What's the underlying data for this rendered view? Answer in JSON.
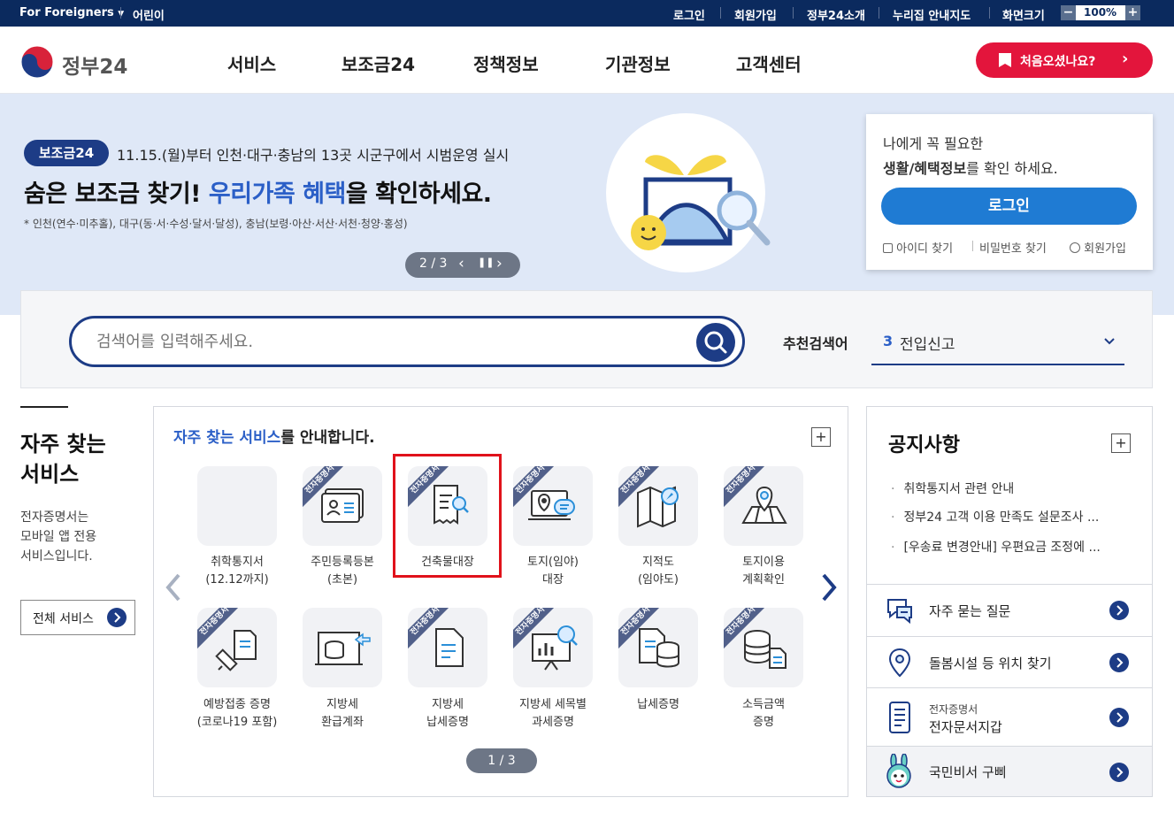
{
  "topbar": {
    "for_foreigners": "For Foreigners",
    "kids": "어린이",
    "login": "로그인",
    "signup": "회원가입",
    "about": "정부24소개",
    "sitemap": "누리집 안내지도",
    "screen_size": "화면크기",
    "zoom_minus": "−",
    "zoom_value": "100%",
    "zoom_plus": "+"
  },
  "header": {
    "logo_text": "정부24",
    "nav": [
      "서비스",
      "보조금24",
      "정책정보",
      "기관정보",
      "고객센터"
    ],
    "first_visit": "처음오셨나요?"
  },
  "hero": {
    "badge": "보조금24",
    "notice": "11.15.(월)부터 인천·대구·충남의 13곳 시군구에서 시범운영 실시",
    "headline_a": "숨은 보조금 찾기! ",
    "headline_b": "우리가족 혜택",
    "headline_c": "을 확인하세요.",
    "subnote": "* 인천(연수·미추홀), 대구(동·서·수성·달서·달성), 충남(보령·아산·서산·서천·청양·홍성)",
    "pager": "2 / 3"
  },
  "login_card": {
    "line1": "나에게 꼭 필요한",
    "line2_bold": "생활/혜택정보",
    "line2_rest": "를 확인 하세요.",
    "login_button": "로그인",
    "find_id": "아이디 찾기",
    "find_pw": "비밀번호 찾기",
    "join": "회원가입"
  },
  "search": {
    "placeholder": "검색어를 입력해주세요.",
    "recommended_label": "추천검색어",
    "recommended_rank": "3",
    "recommended_term": "전입신고"
  },
  "left": {
    "title_line1": "자주 찾는",
    "title_line2": "서비스",
    "desc_line1": "전자증명서는",
    "desc_line2": "모바일 앱 전용",
    "desc_line3": "서비스입니다.",
    "all_services": "전체 서비스"
  },
  "services": {
    "heading_highlight": "자주 찾는 서비스",
    "heading_rest": "를 안내합니다.",
    "ribbon_text": "전자증명서",
    "pager": "1 / 3",
    "row1": [
      {
        "line1": "취학통지서",
        "line2": "(12.12까지)",
        "icon": "blank",
        "ribbon": false
      },
      {
        "line1": "주민등록등본",
        "line2": "(초본)",
        "icon": "id-card-icon",
        "ribbon": true
      },
      {
        "line1": "건축물대장",
        "line2": "",
        "icon": "document-search-icon",
        "ribbon": true
      },
      {
        "line1": "토지(임야)",
        "line2": "대장",
        "icon": "monitor-location-icon",
        "ribbon": true
      },
      {
        "line1": "지적도",
        "line2": "(임야도)",
        "icon": "map-compass-icon",
        "ribbon": true
      },
      {
        "line1": "토지이용",
        "line2": "계획확인",
        "icon": "map-pin-icon",
        "ribbon": true
      }
    ],
    "row2": [
      {
        "line1": "예방접종 증명",
        "line2": "(코로나19 포함)",
        "icon": "syringe-icon",
        "ribbon": true
      },
      {
        "line1": "지방세",
        "line2": "환급계좌",
        "icon": "coin-return-icon",
        "ribbon": false
      },
      {
        "line1": "지방세",
        "line2": "납세증명",
        "icon": "tax-document-icon",
        "ribbon": true
      },
      {
        "line1": "지방세 세목별",
        "line2": "과세증명",
        "icon": "chart-board-icon",
        "ribbon": true
      },
      {
        "line1": "납세증명",
        "line2": "",
        "icon": "coin-document-icon",
        "ribbon": true
      },
      {
        "line1": "소득금액",
        "line2": "증명",
        "icon": "coin-stack-icon",
        "ribbon": true
      }
    ]
  },
  "notice": {
    "title": "공지사항",
    "items": [
      "취학통지서 관련 안내",
      "정부24 고객 이용 만족도 설문조사 ...",
      "[우송료 변경안내] 우편요금 조정에 ..."
    ],
    "faq": "자주 묻는 질문",
    "care_location": "돌봄시설 등 위치 찾기",
    "ecert_small": "전자증명서",
    "ecert_wallet": "전자문서지갑",
    "assistant": "국민비서 구삐"
  },
  "colors": {
    "navy": "#0b2a5e",
    "brand_blue": "#1d3c86",
    "accent_red": "#e3153c",
    "login_blue": "#1f7bd3",
    "highlight_blue": "#2b5fc7"
  }
}
